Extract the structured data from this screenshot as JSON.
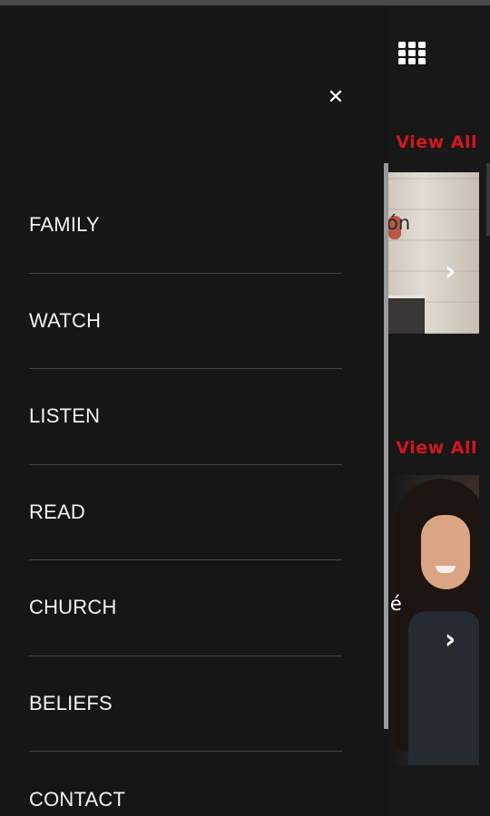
{
  "background": {
    "grid_icon": "apps-grid-icon",
    "sections": [
      {
        "view_all": "View All",
        "card_text_fragment": "ón",
        "chevron_icon": "chevron-right-icon"
      },
      {
        "view_all": "View All",
        "card_text_fragment": "lé",
        "chevron_icon": "chevron-right-icon"
      }
    ]
  },
  "drawer": {
    "close_icon": "close-icon",
    "menu": [
      {
        "label": "FAMILY"
      },
      {
        "label": "WATCH"
      },
      {
        "label": "LISTEN"
      },
      {
        "label": "READ"
      },
      {
        "label": "CHURCH"
      },
      {
        "label": "BELIEFS"
      },
      {
        "label": "CONTACT"
      }
    ]
  },
  "colors": {
    "accent": "#d0181e",
    "drawer_bg": "#161616",
    "page_bg": "#181818"
  }
}
